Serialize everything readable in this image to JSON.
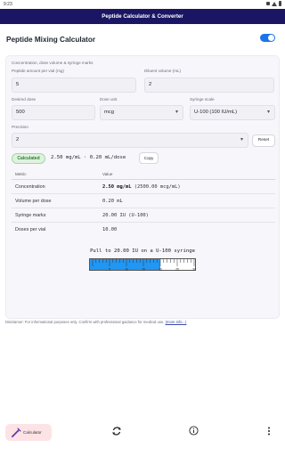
{
  "status_bar": {
    "time": "9:23"
  },
  "app_bar": {
    "title": "Peptide Calculator & Converter"
  },
  "header": {
    "title": "Peptide Mixing Calculator",
    "toggle_on": true
  },
  "form": {
    "section_label": "Concentration, dose volume & syringe marks",
    "peptide_amount": {
      "label": "Peptide amount per vial (mg)",
      "value": "5"
    },
    "diluent_volume": {
      "label": "Diluent volume (mL)",
      "value": "2"
    },
    "desired_dose": {
      "label": "Desired dose",
      "value": "500"
    },
    "dose_unit": {
      "label": "Dose unit",
      "value": "mcg"
    },
    "syringe_scale": {
      "label": "Syringe scale",
      "value": "U-100 (100 IU/mL)"
    },
    "precision": {
      "label": "Precision",
      "value": "2"
    },
    "reset_label": "Reset"
  },
  "summary": {
    "chip": "Calculated",
    "text": "2.50 mg/mL · 0.20 mL/dose",
    "copy_label": "Copy"
  },
  "table": {
    "headers": [
      "Metric",
      "Value"
    ],
    "rows": [
      {
        "metric": "Concentration",
        "value_main": "2.50 mg/mL",
        "value_extra": " (2500.00 mcg/mL)"
      },
      {
        "metric": "Volume per dose",
        "value_main": "",
        "value_extra": "0.20 mL"
      },
      {
        "metric": "Syringe marks",
        "value_main": "",
        "value_extra": "20.00 IU (U-100)"
      },
      {
        "metric": "Doses per vial",
        "value_main": "",
        "value_extra": "10.00"
      }
    ]
  },
  "syringe": {
    "caption": "Pull to 20.00 IU on a U-100 syringe",
    "fill_fraction": 0.67,
    "tick_labels": [
      "5",
      "10",
      "15",
      "20",
      "25",
      "30"
    ]
  },
  "disclaimer": {
    "text": "Disclaimer: For informational purposes only. Confirm with professional guidance for medical use.",
    "link": "(more info...)"
  },
  "bottom_nav": {
    "calculator_label": "Calculator"
  },
  "colors": {
    "app_bar": "#1a1663",
    "accent": "#1a73e8",
    "fill": "#2196f3",
    "chip_bg": "#dff2df",
    "nav_active": "#fde3e6"
  }
}
